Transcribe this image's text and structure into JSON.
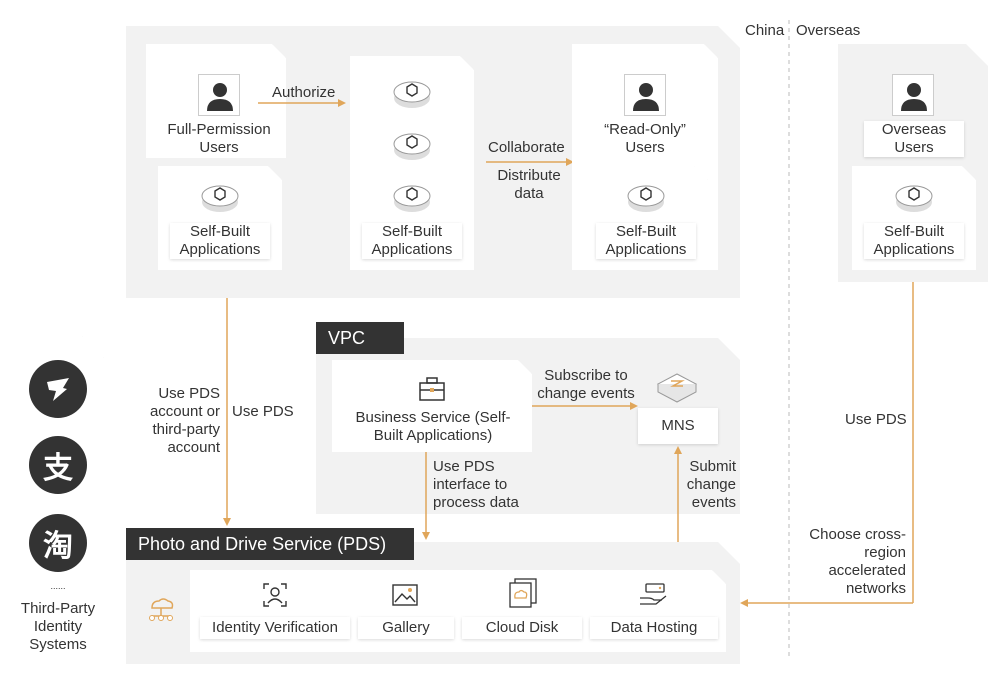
{
  "regions": {
    "china": "China",
    "overseas": "Overseas"
  },
  "top": {
    "full_permission_users": "Full-Permission Users",
    "authorize": "Authorize",
    "self_built_apps_left": "Self-Built Applications",
    "self_built_apps_middle": "Self-Built Applications",
    "collaborate": "Collaborate",
    "distribute_data": "Distribute data",
    "read_only_users": "“Read-Only” Users",
    "self_built_apps_right": "Self-Built Applications",
    "overseas_users": "Overseas Users",
    "self_built_apps_overseas": "Self-Built Applications"
  },
  "third_party": {
    "label": "Third-Party Identity Systems",
    "ellipsis": "......",
    "icons": [
      "dingtalk-icon",
      "alipay-icon",
      "taobao-icon"
    ],
    "alipay_glyph": "支",
    "taobao_glyph": "淘"
  },
  "flows": {
    "use_pds_account": "Use PDS account or third-party account",
    "use_pds_left": "Use PDS",
    "use_pds_right": "Use PDS",
    "choose_networks": "Choose cross-region accelerated networks",
    "subscribe": "Subscribe to change events",
    "submit": "Submit change events",
    "process": "Use PDS interface to process data"
  },
  "vpc": {
    "title": "VPC",
    "business_service": "Business Service (Self-Built Applications)",
    "mns": "MNS"
  },
  "pds": {
    "title": "Photo and Drive Service (PDS)",
    "features": [
      "Identity Verification",
      "Gallery",
      "Cloud Disk",
      "Data Hosting"
    ]
  },
  "colors": {
    "accent": "#e0a65a",
    "dark": "#333333",
    "panel": "#f2f2f2"
  }
}
